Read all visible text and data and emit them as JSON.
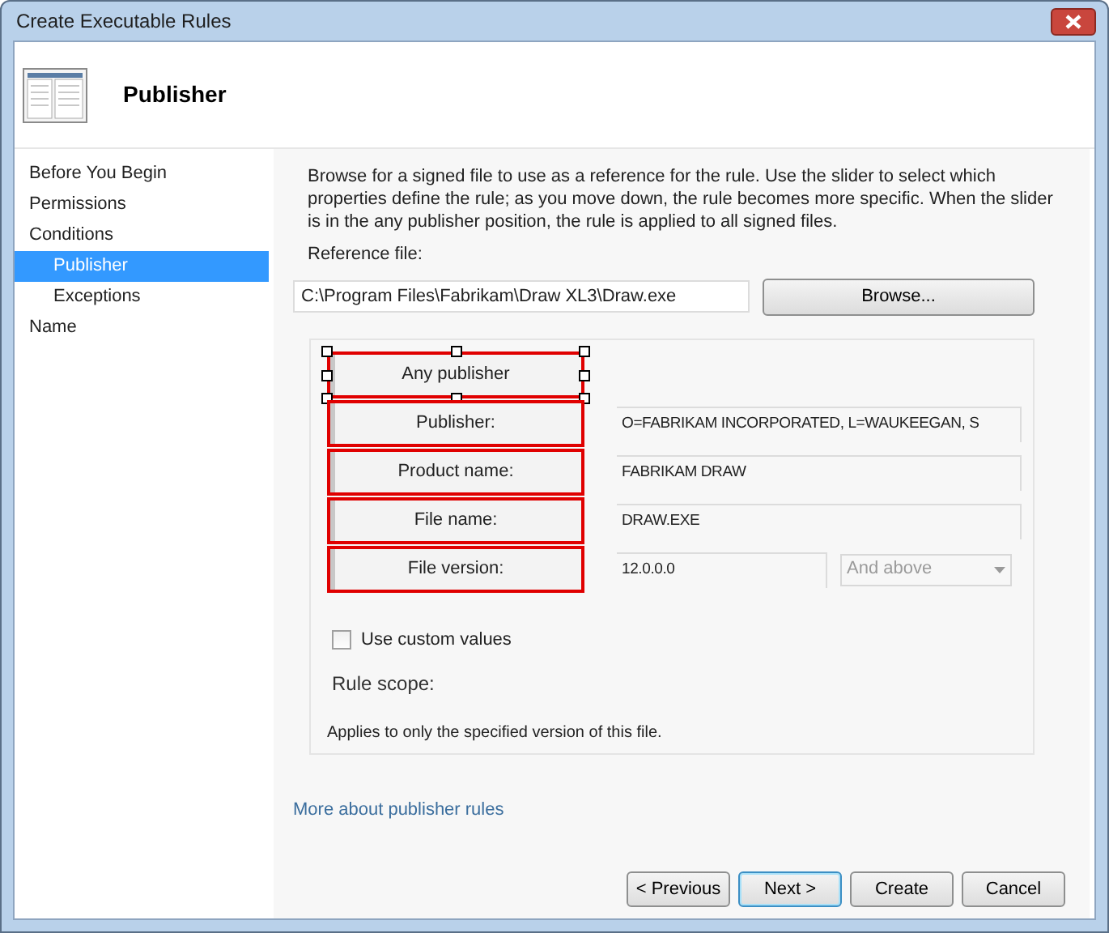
{
  "window": {
    "title": "Create Executable Rules"
  },
  "header": {
    "title": "Publisher"
  },
  "sidebar": {
    "items": [
      {
        "label": "Before You Begin",
        "selected": false
      },
      {
        "label": "Permissions",
        "selected": false
      },
      {
        "label": "Conditions",
        "selected": false,
        "children": [
          {
            "label": "Publisher",
            "selected": true
          },
          {
            "label": "Exceptions",
            "selected": false
          }
        ]
      },
      {
        "label": "Name",
        "selected": false
      }
    ]
  },
  "description": "Browse for a signed file to use as a reference for the rule. Use the slider to select which properties define the rule; as you move down, the rule becomes more specific. When the slider is in the any publisher position, the rule is applied to all signed files.",
  "reference_file": {
    "label": "Reference file:",
    "value": "C:\\Program Files\\Fabrikam\\Draw XL3\\Draw.exe",
    "button": "Browse..."
  },
  "slider_levels": [
    {
      "label": "Any publisher",
      "selected": true
    },
    {
      "label": "Publisher:",
      "selected": false,
      "value": "O=FABRIKAM INCORPORATED, L=WAUKEEGAN, S"
    },
    {
      "label": "Product name:",
      "selected": false,
      "value": "FABRIKAM DRAW"
    },
    {
      "label": "File name:",
      "selected": false,
      "value": "DRAW.EXE"
    },
    {
      "label": "File version:",
      "selected": false,
      "value": "12.0.0.0",
      "dropdown": "And above"
    }
  ],
  "custom_values": {
    "label": "Use custom values",
    "checked": false
  },
  "rule_scope": {
    "label": "Rule scope:",
    "text": "Applies to only the specified version of this file."
  },
  "link": "More about publisher rules",
  "buttons": [
    {
      "label": "< Previous",
      "default": false
    },
    {
      "label": "Next >",
      "default": true
    },
    {
      "label": "Create",
      "default": false
    },
    {
      "label": "Cancel",
      "default": false
    }
  ]
}
